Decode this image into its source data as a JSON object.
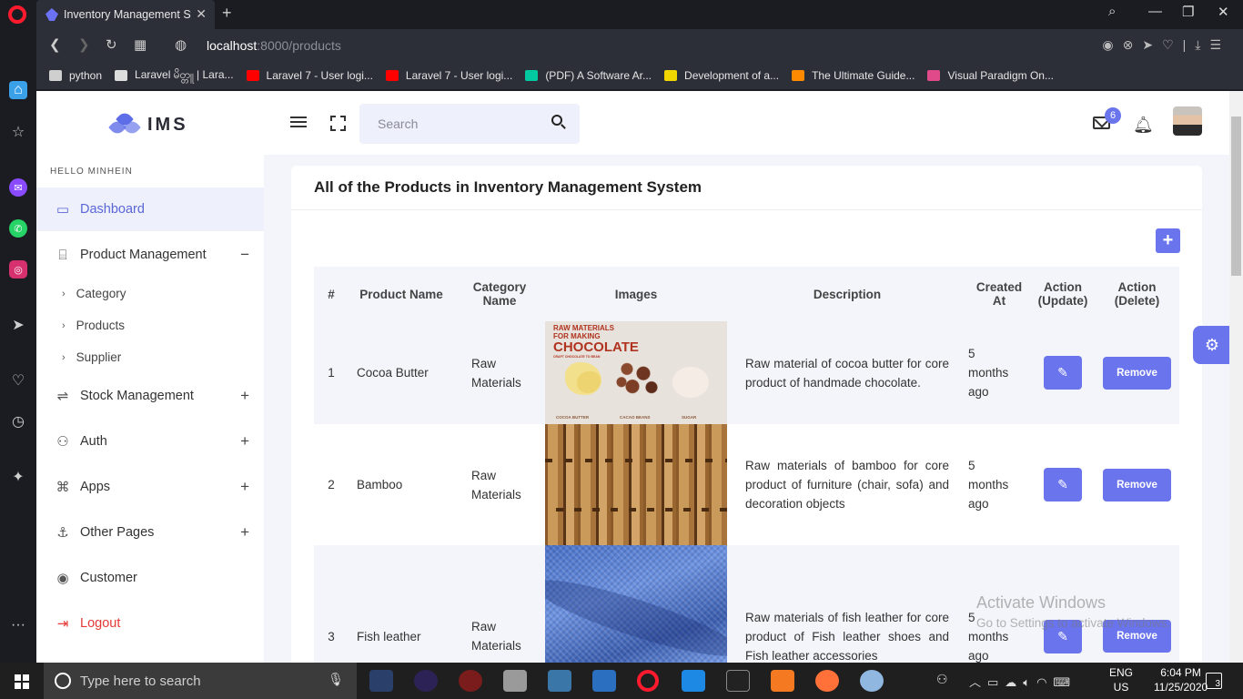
{
  "browser": {
    "tab_title": "Inventory Management Sys",
    "url_host": "localhost",
    "url_rest": ":8000/products",
    "bookmarks": [
      {
        "label": "python",
        "color": "#cfcfcf"
      },
      {
        "label": "Laravel မိတ္တူ | Lara...",
        "color": "#dddddd"
      },
      {
        "label": "Laravel 7 - User logi...",
        "color": "#ff0000"
      },
      {
        "label": "Laravel 7 - User logi...",
        "color": "#ff0000"
      },
      {
        "label": "(PDF) A Software Ar...",
        "color": "#00c8a0"
      },
      {
        "label": "Development of a...",
        "color": "#f2d600"
      },
      {
        "label": "The Ultimate Guide...",
        "color": "#ff8a00"
      },
      {
        "label": "Visual Paradigm On...",
        "color": "#e04a8a"
      }
    ]
  },
  "app": {
    "brand": "IMS",
    "greeting": "HELLO MINHEIN",
    "nav": {
      "dashboard": "Dashboard",
      "product_management": "Product Management",
      "category": "Category",
      "products": "Products",
      "supplier": "Supplier",
      "stock_management": "Stock Management",
      "auth": "Auth",
      "apps": "Apps",
      "other_pages": "Other Pages",
      "customer": "Customer",
      "logout": "Logout"
    },
    "search_placeholder": "Search",
    "mail_badge": "6",
    "card_title": "All of the Products in Inventory Management System",
    "table": {
      "headers": {
        "num": "#",
        "name": "Product Name",
        "cat1": "Category",
        "cat2": "Name",
        "images": "Images",
        "desc": "Description",
        "created1": "Created",
        "created2": "At",
        "upd1": "Action",
        "upd2": "(Update)",
        "del1": "Action",
        "del2": "(Delete)"
      },
      "rows": [
        {
          "num": "1",
          "name": "Cocoa Butter",
          "cat1": "Raw",
          "cat2": "Materials",
          "desc": "Raw material of cocoa butter for core product of handmade chocolate.",
          "created1": "5",
          "created2": "months",
          "created3": "ago",
          "remove": "Remove",
          "img_line1": "RAW MATERIALS",
          "img_line2": "FOR MAKING",
          "img_line3": "CHOCOLATE",
          "img_line4": "CRAFT CHOCOLATE TO BEAN",
          "img_cap1": "COCOA BUTTER",
          "img_cap2": "CACAO BEANS",
          "img_cap3": "SUGAR"
        },
        {
          "num": "2",
          "name": "Bamboo",
          "cat1": "Raw",
          "cat2": "Materials",
          "desc": "Raw materials of bamboo for core product of furniture (chair, sofa) and decoration objects",
          "created1": "5",
          "created2": "months",
          "created3": "ago",
          "remove": "Remove"
        },
        {
          "num": "3",
          "name": "Fish leather",
          "cat1": "Raw",
          "cat2": "Materials",
          "desc": "Raw materials of fish leather for core product of Fish leather shoes and Fish leather accessories",
          "created1": "5",
          "created2": "months",
          "created3": "ago",
          "remove": "Remove"
        }
      ]
    }
  },
  "watermark": {
    "line1": "Activate Windows",
    "line2": "Go to Settings to activate Windows."
  },
  "taskbar": {
    "search_placeholder": "Type here to search",
    "lang1": "ENG",
    "lang2": "US",
    "time": "6:04 PM",
    "date": "11/25/2020",
    "notifications": "3"
  },
  "colors": {
    "accent": "#6a74ec",
    "logout": "#e53935"
  }
}
